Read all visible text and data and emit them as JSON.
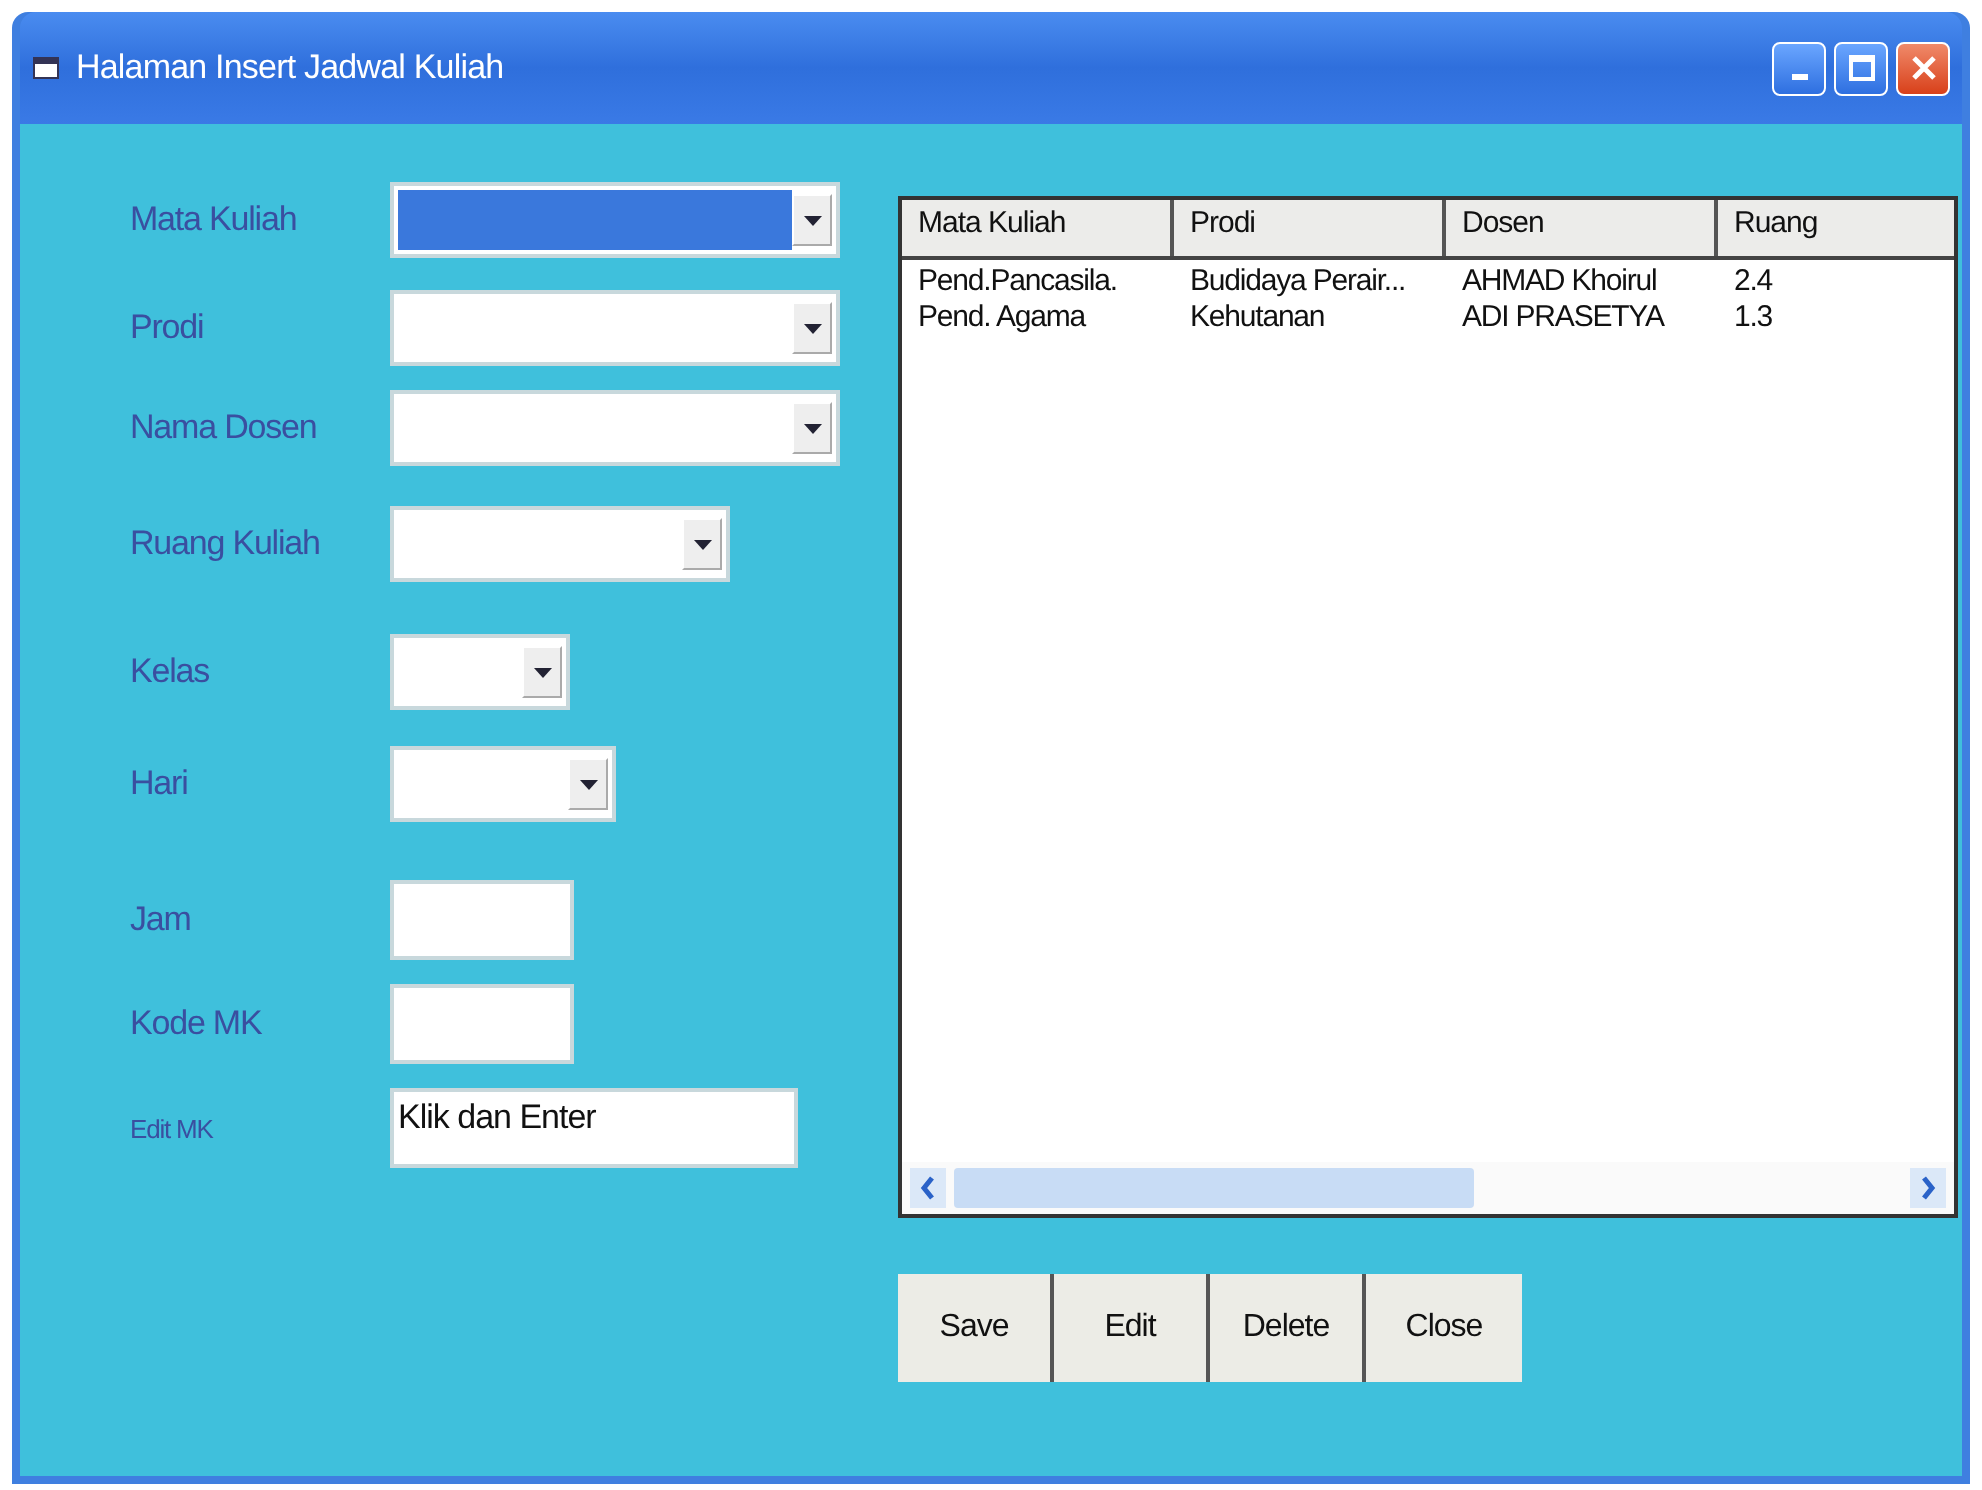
{
  "window": {
    "title": "Halaman Insert Jadwal Kuliah"
  },
  "fields": [
    {
      "label": "Mata Kuliah",
      "kind": "combo",
      "selected": true
    },
    {
      "label": "Prodi",
      "kind": "combo",
      "selected": false
    },
    {
      "label": "Nama Dosen",
      "kind": "combo",
      "selected": false
    },
    {
      "label": "Ruang Kuliah",
      "kind": "combo",
      "selected": false
    },
    {
      "label": "Kelas",
      "kind": "combo",
      "selected": false
    },
    {
      "label": "Hari",
      "kind": "combo",
      "selected": false
    },
    {
      "label": "Jam",
      "kind": "text",
      "selected": false
    },
    {
      "label": "Kode MK",
      "kind": "text",
      "selected": false
    },
    {
      "label": "Edit MK",
      "kind": "text",
      "selected": false,
      "value": "Klik dan Enter"
    }
  ],
  "table": {
    "columns": [
      "Mata Kuliah",
      "Prodi",
      "Dosen",
      "Ruang"
    ],
    "rows": [
      [
        "Pend.Pancasila.",
        "Budidaya Perair...",
        "AHMAD Khoirul",
        "2.4"
      ],
      [
        "Pend. Agama",
        "Kehutanan",
        "ADI PRASETYA",
        "1.3"
      ]
    ]
  },
  "buttons": [
    "Save",
    "Edit",
    "Delete",
    "Close"
  ]
}
